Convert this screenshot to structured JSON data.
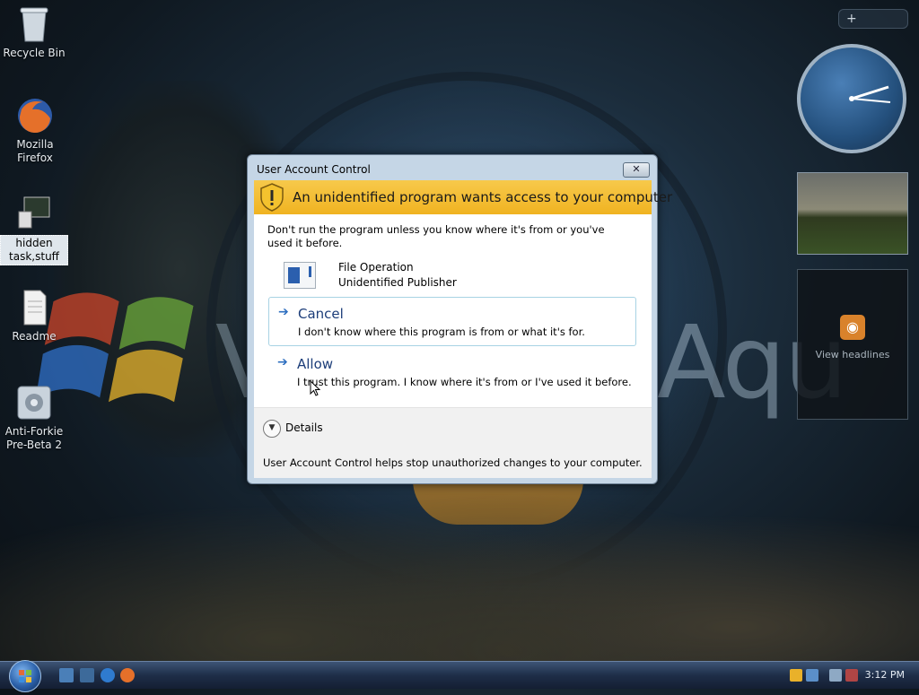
{
  "desktop": {
    "icons": [
      {
        "label": "Recycle Bin"
      },
      {
        "label": "Mozilla Firefox"
      },
      {
        "label": "hidden task,stuff"
      },
      {
        "label": "Readme"
      },
      {
        "label": "Anti-Forkie Pre-Beta 2"
      }
    ],
    "background_text_right": "Aqu",
    "background_text_left": "V"
  },
  "gadgets": {
    "add_label": "+",
    "feed_label": "View headlines"
  },
  "dialog": {
    "title": "User Account Control",
    "close_glyph": "✕",
    "banner_text": "An unidentified program wants access to your computer",
    "warning": "Don't run the program unless you know where it's from or you've used it before.",
    "program_name": "File Operation",
    "publisher": "Unidentified Publisher",
    "cancel": {
      "heading": "Cancel",
      "description": "I don't know where this program is from or what it's for."
    },
    "allow": {
      "heading": "Allow",
      "description": "I trust this program. I know where it's from or I've used it before."
    },
    "details_label": "Details",
    "footer_text": "User Account Control helps stop unauthorized changes to your computer.",
    "banner_color": "#f2b82a",
    "choice_text_color": "#1c3d79"
  },
  "taskbar": {
    "time": "3:12 PM"
  },
  "icons": {
    "start": "windows-start-orb",
    "arrow": "blue-right-arrow",
    "details": "chevron-down-circle"
  }
}
